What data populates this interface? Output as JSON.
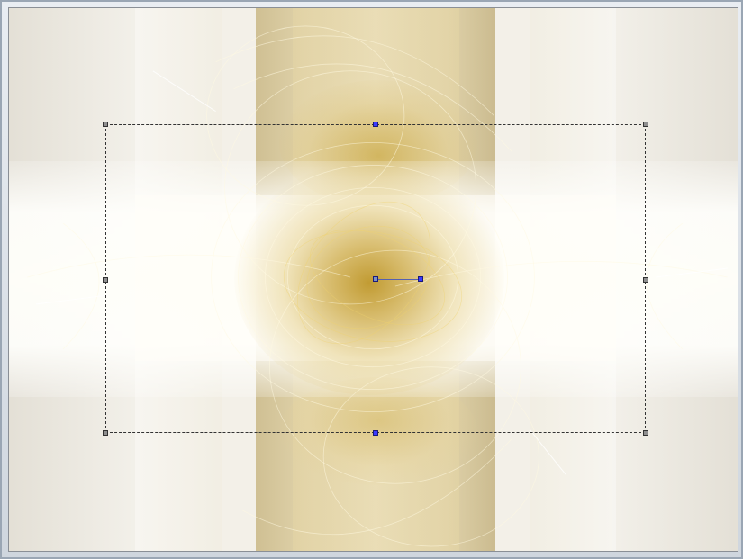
{
  "window": {
    "title": ""
  },
  "canvas": {
    "description_icon": "image-canvas-icon",
    "colors": {
      "gold": "#c29a2e",
      "gold_light": "#e4cf8e",
      "cream": "#fffdf5",
      "band": "#cdb983",
      "selection_border": "#333333",
      "handle_gray": "#8f8f8f",
      "handle_blue": "#3a3aff"
    }
  },
  "selection": {
    "style": "dashed",
    "handles": [
      {
        "name": "handle-top-left",
        "kind": "corner"
      },
      {
        "name": "handle-top-center",
        "kind": "rotate"
      },
      {
        "name": "handle-top-right",
        "kind": "corner"
      },
      {
        "name": "handle-middle-left",
        "kind": "edge"
      },
      {
        "name": "handle-middle-right",
        "kind": "edge"
      },
      {
        "name": "handle-bottom-left",
        "kind": "corner"
      },
      {
        "name": "handle-bottom-center",
        "kind": "edge-blue"
      },
      {
        "name": "handle-bottom-right",
        "kind": "corner"
      },
      {
        "name": "handle-center-pivot",
        "kind": "pivot"
      },
      {
        "name": "handle-rotation-arm",
        "kind": "rotation-arm"
      }
    ]
  }
}
